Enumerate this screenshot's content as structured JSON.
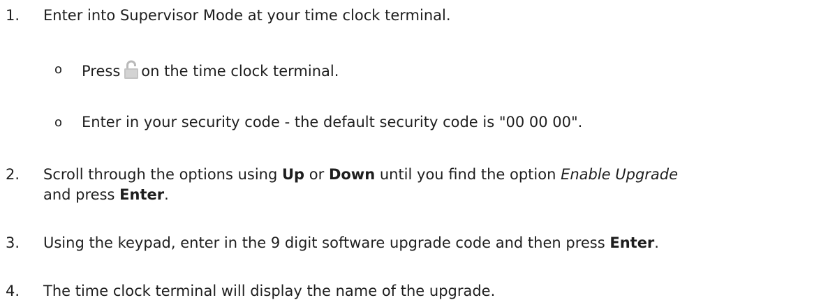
{
  "steps": [
    {
      "number": "1.",
      "text": "Enter into Supervisor Mode at your time clock terminal.",
      "bullets": [
        {
          "symbol": "o",
          "before": "Press",
          "icon": "unlock-icon",
          "after": "on the time clock terminal."
        },
        {
          "symbol": "o",
          "text": "Enter in your security code - the default security code is \"00 00 00\"."
        }
      ]
    },
    {
      "number": "2.",
      "t1": "Scroll through the options using ",
      "b1": "Up",
      "t2": " or ",
      "b2": "Down",
      "t3": " until you find the option ",
      "i1": "Enable Upgrade",
      "t4": "and press ",
      "b3": "Enter",
      "t5": "."
    },
    {
      "number": "3.",
      "t1": "Using the keypad, enter in the 9 digit software upgrade code and then press ",
      "b1": "Enter",
      "t2": "."
    },
    {
      "number": "4.",
      "text": "The time clock terminal will display the name of the upgrade."
    }
  ]
}
